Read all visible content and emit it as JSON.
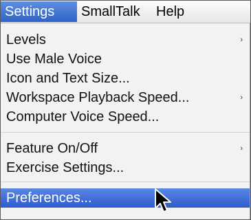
{
  "menubar": {
    "titles": [
      "Settings",
      "SmallTalk",
      "Help"
    ]
  },
  "dropdown": {
    "items": [
      {
        "label": "Levels",
        "submenu_indicator": "›"
      },
      {
        "label": "Use Male Voice"
      },
      {
        "label": "Icon and Text Size..."
      },
      {
        "label": "Workspace Playback Speed...",
        "submenu_indicator": "›"
      },
      {
        "label": "Computer Voice Speed..."
      },
      {
        "label": "Feature On/Off",
        "submenu_indicator": "›"
      },
      {
        "label": "Exercise Settings..."
      },
      {
        "label": "Preferences...",
        "state": "highlighted"
      }
    ]
  },
  "colors": {
    "highlight": "#2f63c8",
    "menu_background": "#f2f2f2"
  },
  "icons": {
    "cursor": "arrow-cursor-icon"
  }
}
